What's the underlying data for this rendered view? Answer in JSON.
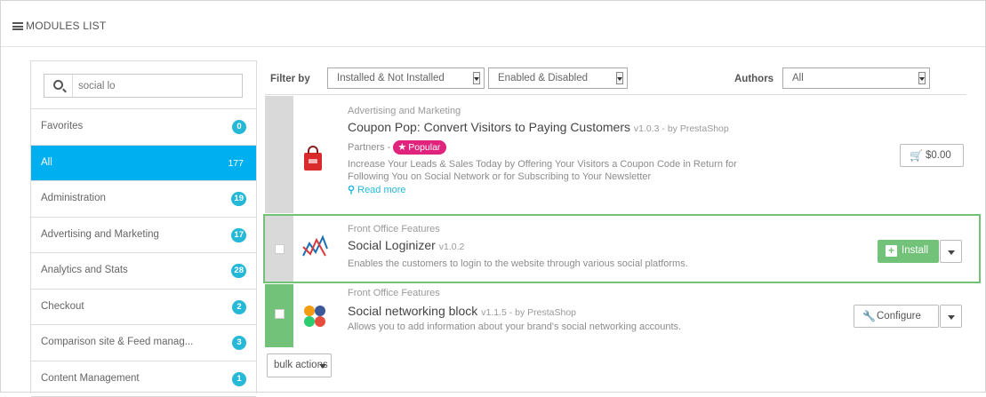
{
  "panel": {
    "title": "MODULES LIST"
  },
  "search": {
    "value": "social lo"
  },
  "categories": [
    {
      "label": "Favorites",
      "count": "0",
      "active": false
    },
    {
      "label": "All",
      "count": "177",
      "active": true
    },
    {
      "label": "Administration",
      "count": "19",
      "active": false
    },
    {
      "label": "Advertising and Marketing",
      "count": "17",
      "active": false
    },
    {
      "label": "Analytics and Stats",
      "count": "28",
      "active": false
    },
    {
      "label": "Checkout",
      "count": "2",
      "active": false
    },
    {
      "label": "Comparison site & Feed manag...",
      "count": "3",
      "active": false
    },
    {
      "label": "Content Management",
      "count": "1",
      "active": false
    }
  ],
  "filters": {
    "filter_label": "Filter by",
    "install_select": "Installed & Not Installed",
    "enabled_select": "Enabled & Disabled",
    "authors_label": "Authors",
    "authors_select": "All"
  },
  "modules": [
    {
      "category": "Advertising and Marketing",
      "name": "Coupon Pop: Convert Visitors to Paying Customers",
      "version": "v1.0.3 - by PrestaShop",
      "partners_label": "Partners -",
      "popular_badge": "Popular",
      "description_1": "Increase Your Leads & Sales Today by Offering Your Visitors a Coupon Code in Return for",
      "description_2": "Following You on Social Network or for Subscribing to Your Newsletter",
      "read_more": "Read more",
      "action": "$0.00"
    },
    {
      "category": "Front Office Features",
      "name": "Social Loginizer",
      "version": "v1.0.2",
      "description": "Enables the customers to login to the website through various social platforms.",
      "action": "Install"
    },
    {
      "category": "Front Office Features",
      "name": "Social networking block",
      "version": "v1.1.5 - by PrestaShop",
      "description": "Allows you to add information about your brand's social networking accounts.",
      "action": "Configure"
    }
  ],
  "bulk": {
    "label": "bulk actions"
  },
  "colors": {
    "accent": "#00aff0",
    "badge": "#25b9d7",
    "install": "#72c279",
    "popular": "#e0237d"
  }
}
